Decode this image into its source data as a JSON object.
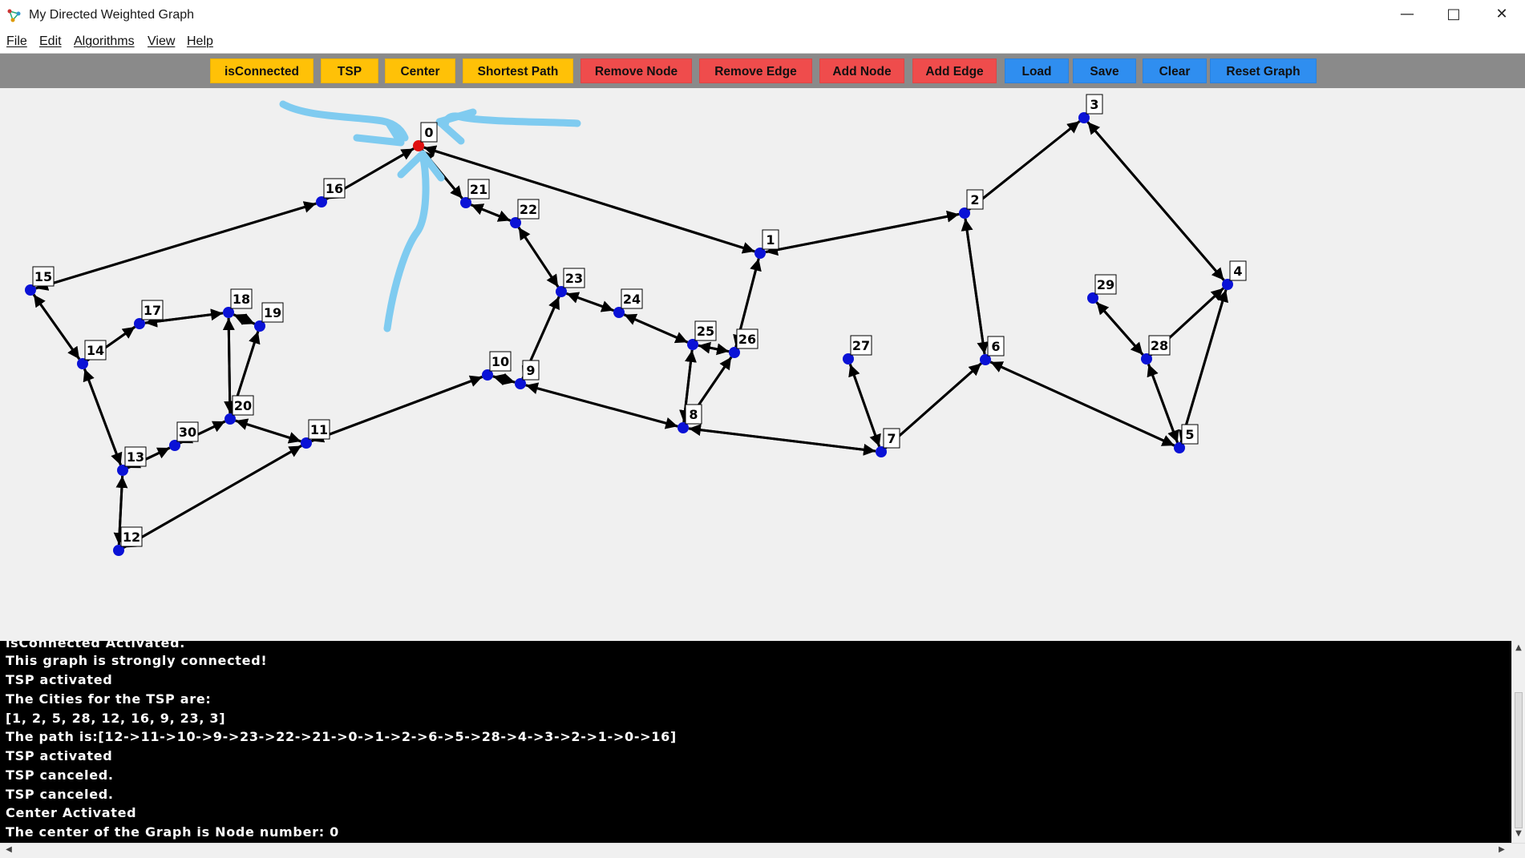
{
  "window": {
    "title": "My Directed Weighted Graph",
    "minimize_icon": "minimize-icon",
    "maximize_icon": "maximize-icon",
    "close_icon": "close-icon"
  },
  "menu": [
    "File",
    "Edit",
    "Algorithms",
    "View",
    "Help"
  ],
  "toolbar": [
    {
      "label": "isConnected",
      "color": "#ffc107",
      "text_color": "#111111"
    },
    {
      "label": "TSP",
      "color": "#ffc107",
      "text_color": "#111111"
    },
    {
      "label": "Center",
      "color": "#ffc107",
      "text_color": "#111111"
    },
    {
      "label": "Shortest Path",
      "color": "#ffc107",
      "text_color": "#111111"
    },
    {
      "label": "Remove Node",
      "color": "#ef4c4c",
      "text_color": "#111111"
    },
    {
      "label": "Remove Edge",
      "color": "#ef4c4c",
      "text_color": "#111111"
    },
    {
      "label": "Add Node",
      "color": "#ef4c4c",
      "text_color": "#111111"
    },
    {
      "label": "Add Edge",
      "color": "#ef4c4c",
      "text_color": "#111111"
    },
    {
      "label": "Load",
      "color": "#2f8ef0",
      "text_color": "#111111"
    },
    {
      "label": "Save",
      "color": "#2f8ef0",
      "text_color": "#111111"
    },
    {
      "label": "Clear",
      "color": "#2f8ef0",
      "text_color": "#111111"
    },
    {
      "label": "Reset Graph",
      "color": "#2f8ef0",
      "text_color": "#111111"
    }
  ],
  "graph": {
    "nodes": [
      {
        "id": "0",
        "highlighted": true
      },
      {
        "id": "1"
      },
      {
        "id": "2"
      },
      {
        "id": "3"
      },
      {
        "id": "4"
      },
      {
        "id": "5"
      },
      {
        "id": "6"
      },
      {
        "id": "7"
      },
      {
        "id": "8"
      },
      {
        "id": "9"
      },
      {
        "id": "10"
      },
      {
        "id": "11"
      },
      {
        "id": "12"
      },
      {
        "id": "13"
      },
      {
        "id": "14"
      },
      {
        "id": "15"
      },
      {
        "id": "16"
      },
      {
        "id": "17"
      },
      {
        "id": "18"
      },
      {
        "id": "19"
      },
      {
        "id": "20"
      },
      {
        "id": "21"
      },
      {
        "id": "22"
      },
      {
        "id": "23"
      },
      {
        "id": "24"
      },
      {
        "id": "25"
      },
      {
        "id": "26"
      },
      {
        "id": "27"
      },
      {
        "id": "28"
      },
      {
        "id": "29"
      },
      {
        "id": "30"
      }
    ],
    "edges": [
      [
        "0",
        "1"
      ],
      [
        "1",
        "0"
      ],
      [
        "1",
        "2"
      ],
      [
        "2",
        "1"
      ],
      [
        "2",
        "3"
      ],
      [
        "3",
        "2"
      ],
      [
        "3",
        "4"
      ],
      [
        "4",
        "3"
      ],
      [
        "4",
        "5"
      ],
      [
        "5",
        "4"
      ],
      [
        "5",
        "6"
      ],
      [
        "6",
        "5"
      ],
      [
        "6",
        "7"
      ],
      [
        "7",
        "6"
      ],
      [
        "2",
        "6"
      ],
      [
        "6",
        "2"
      ],
      [
        "5",
        "28"
      ],
      [
        "28",
        "5"
      ],
      [
        "28",
        "4"
      ],
      [
        "4",
        "28"
      ],
      [
        "28",
        "29"
      ],
      [
        "29",
        "28"
      ],
      [
        "27",
        "7"
      ],
      [
        "7",
        "27"
      ],
      [
        "7",
        "8"
      ],
      [
        "8",
        "7"
      ],
      [
        "8",
        "25"
      ],
      [
        "25",
        "8"
      ],
      [
        "8",
        "26"
      ],
      [
        "26",
        "8"
      ],
      [
        "25",
        "26"
      ],
      [
        "26",
        "25"
      ],
      [
        "26",
        "1"
      ],
      [
        "1",
        "26"
      ],
      [
        "25",
        "24"
      ],
      [
        "24",
        "25"
      ],
      [
        "24",
        "23"
      ],
      [
        "23",
        "24"
      ],
      [
        "23",
        "22"
      ],
      [
        "22",
        "23"
      ],
      [
        "22",
        "21"
      ],
      [
        "21",
        "22"
      ],
      [
        "21",
        "0"
      ],
      [
        "0",
        "21"
      ],
      [
        "23",
        "9"
      ],
      [
        "9",
        "23"
      ],
      [
        "9",
        "10"
      ],
      [
        "10",
        "9"
      ],
      [
        "9",
        "8"
      ],
      [
        "8",
        "9"
      ],
      [
        "10",
        "11"
      ],
      [
        "11",
        "10"
      ],
      [
        "11",
        "20"
      ],
      [
        "20",
        "11"
      ],
      [
        "11",
        "12"
      ],
      [
        "12",
        "11"
      ],
      [
        "12",
        "13"
      ],
      [
        "13",
        "12"
      ],
      [
        "13",
        "30"
      ],
      [
        "30",
        "13"
      ],
      [
        "30",
        "20"
      ],
      [
        "20",
        "30"
      ],
      [
        "20",
        "18"
      ],
      [
        "18",
        "20"
      ],
      [
        "20",
        "19"
      ],
      [
        "19",
        "20"
      ],
      [
        "18",
        "19"
      ],
      [
        "19",
        "18"
      ],
      [
        "18",
        "17"
      ],
      [
        "17",
        "18"
      ],
      [
        "17",
        "14"
      ],
      [
        "14",
        "17"
      ],
      [
        "14",
        "13"
      ],
      [
        "13",
        "14"
      ],
      [
        "14",
        "15"
      ],
      [
        "15",
        "14"
      ],
      [
        "15",
        "16"
      ],
      [
        "16",
        "15"
      ],
      [
        "16",
        "0"
      ],
      [
        "0",
        "16"
      ]
    ],
    "node_color": "#0a12d6",
    "highlight_color": "#e01010",
    "highlight_label_bg": "#ffff00",
    "pointer_color": "#7fcbf0",
    "edge_color": "#000000"
  },
  "console": {
    "lines": [
      "isConnected Activated.",
      "This graph is strongly connected!",
      "TSP activated",
      "The Cities for the TSP are:",
      "[1, 2, 5, 28, 12, 16, 9, 23, 3]",
      "The path is:[12->11->10->9->23->22->21->0->1->2->6->5->28->4->3->2->1->0->16]",
      "TSP activated",
      "TSP canceled.",
      "TSP canceled.",
      "Center Activated",
      "The center of the Graph is Node number: 0"
    ]
  }
}
